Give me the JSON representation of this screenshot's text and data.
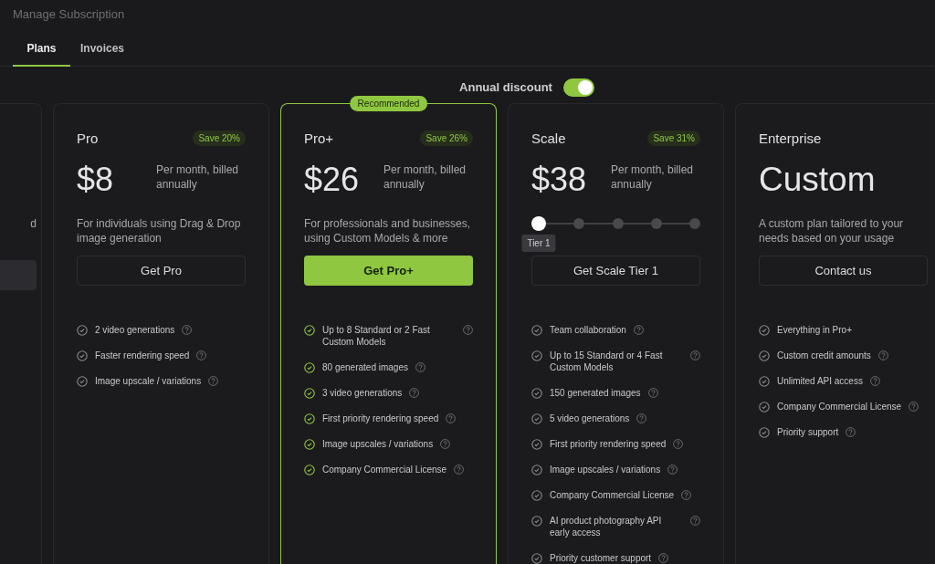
{
  "title": "Manage Subscription",
  "tabs": [
    {
      "label": "Plans",
      "selected": true
    },
    {
      "label": "Invoices",
      "selected": false
    }
  ],
  "annual_discount": {
    "label": "Annual discount",
    "on": true
  },
  "partial_card": {
    "description_fragment": "d"
  },
  "plans": [
    {
      "name": "Pro",
      "save": "Save 20%",
      "price": "$8",
      "price_note": "Per month, billed annually",
      "description": "For individuals using Drag & Drop image generation",
      "button": "Get Pro",
      "highlighted": false,
      "features": [
        {
          "text": "2 video generations",
          "help": true
        },
        {
          "text": "Faster rendering speed",
          "help": true
        },
        {
          "text": "Image upscale / variations",
          "help": true
        }
      ]
    },
    {
      "name": "Pro+",
      "badge": "Recommended",
      "save": "Save 26%",
      "price": "$26",
      "price_note": "Per month, billed annually",
      "description": "For professionals and businesses, using Custom Models & more",
      "button": "Get Pro+",
      "highlighted": true,
      "features": [
        {
          "text": "Up to 8 Standard or 2 Fast Custom Models",
          "help": true
        },
        {
          "text": "80 generated images",
          "help": true
        },
        {
          "text": "3 video generations",
          "help": true
        },
        {
          "text": "First priority rendering speed",
          "help": true
        },
        {
          "text": "Image upscales / variations",
          "help": true
        },
        {
          "text": "Company Commercial License",
          "help": true
        }
      ]
    },
    {
      "name": "Scale",
      "save": "Save 31%",
      "price": "$38",
      "price_note": "Per month, billed annually",
      "tier_slider": {
        "tooltip": "Tier 1",
        "stops": [
          {
            "selected": true
          },
          {
            "selected": false
          },
          {
            "selected": false
          },
          {
            "selected": false
          },
          {
            "selected": false
          }
        ]
      },
      "button": "Get Scale Tier 1",
      "highlighted": false,
      "features": [
        {
          "text": "Team collaboration",
          "help": true
        },
        {
          "text": "Up to 15 Standard or 4 Fast Custom Models",
          "help": true
        },
        {
          "text": "150 generated images",
          "help": true
        },
        {
          "text": "5 video generations",
          "help": true
        },
        {
          "text": "First priority rendering speed",
          "help": true
        },
        {
          "text": "Image upscales / variations",
          "help": true
        },
        {
          "text": "Company Commercial License",
          "help": true
        },
        {
          "text": "AI product photography API early access",
          "help": true
        },
        {
          "text": "Priority customer support",
          "help": true
        }
      ]
    },
    {
      "name": "Enterprise",
      "price": "Custom",
      "description": "A custom plan tailored to your needs based on your usage",
      "button": "Contact us",
      "highlighted": false,
      "features": [
        {
          "text": "Everything in Pro+",
          "help": false
        },
        {
          "text": "Custom credit amounts",
          "help": true
        },
        {
          "text": "Unlimited API access",
          "help": true
        },
        {
          "text": "Company Commercial License",
          "help": true
        },
        {
          "text": "Priority support",
          "help": true
        }
      ]
    }
  ]
}
